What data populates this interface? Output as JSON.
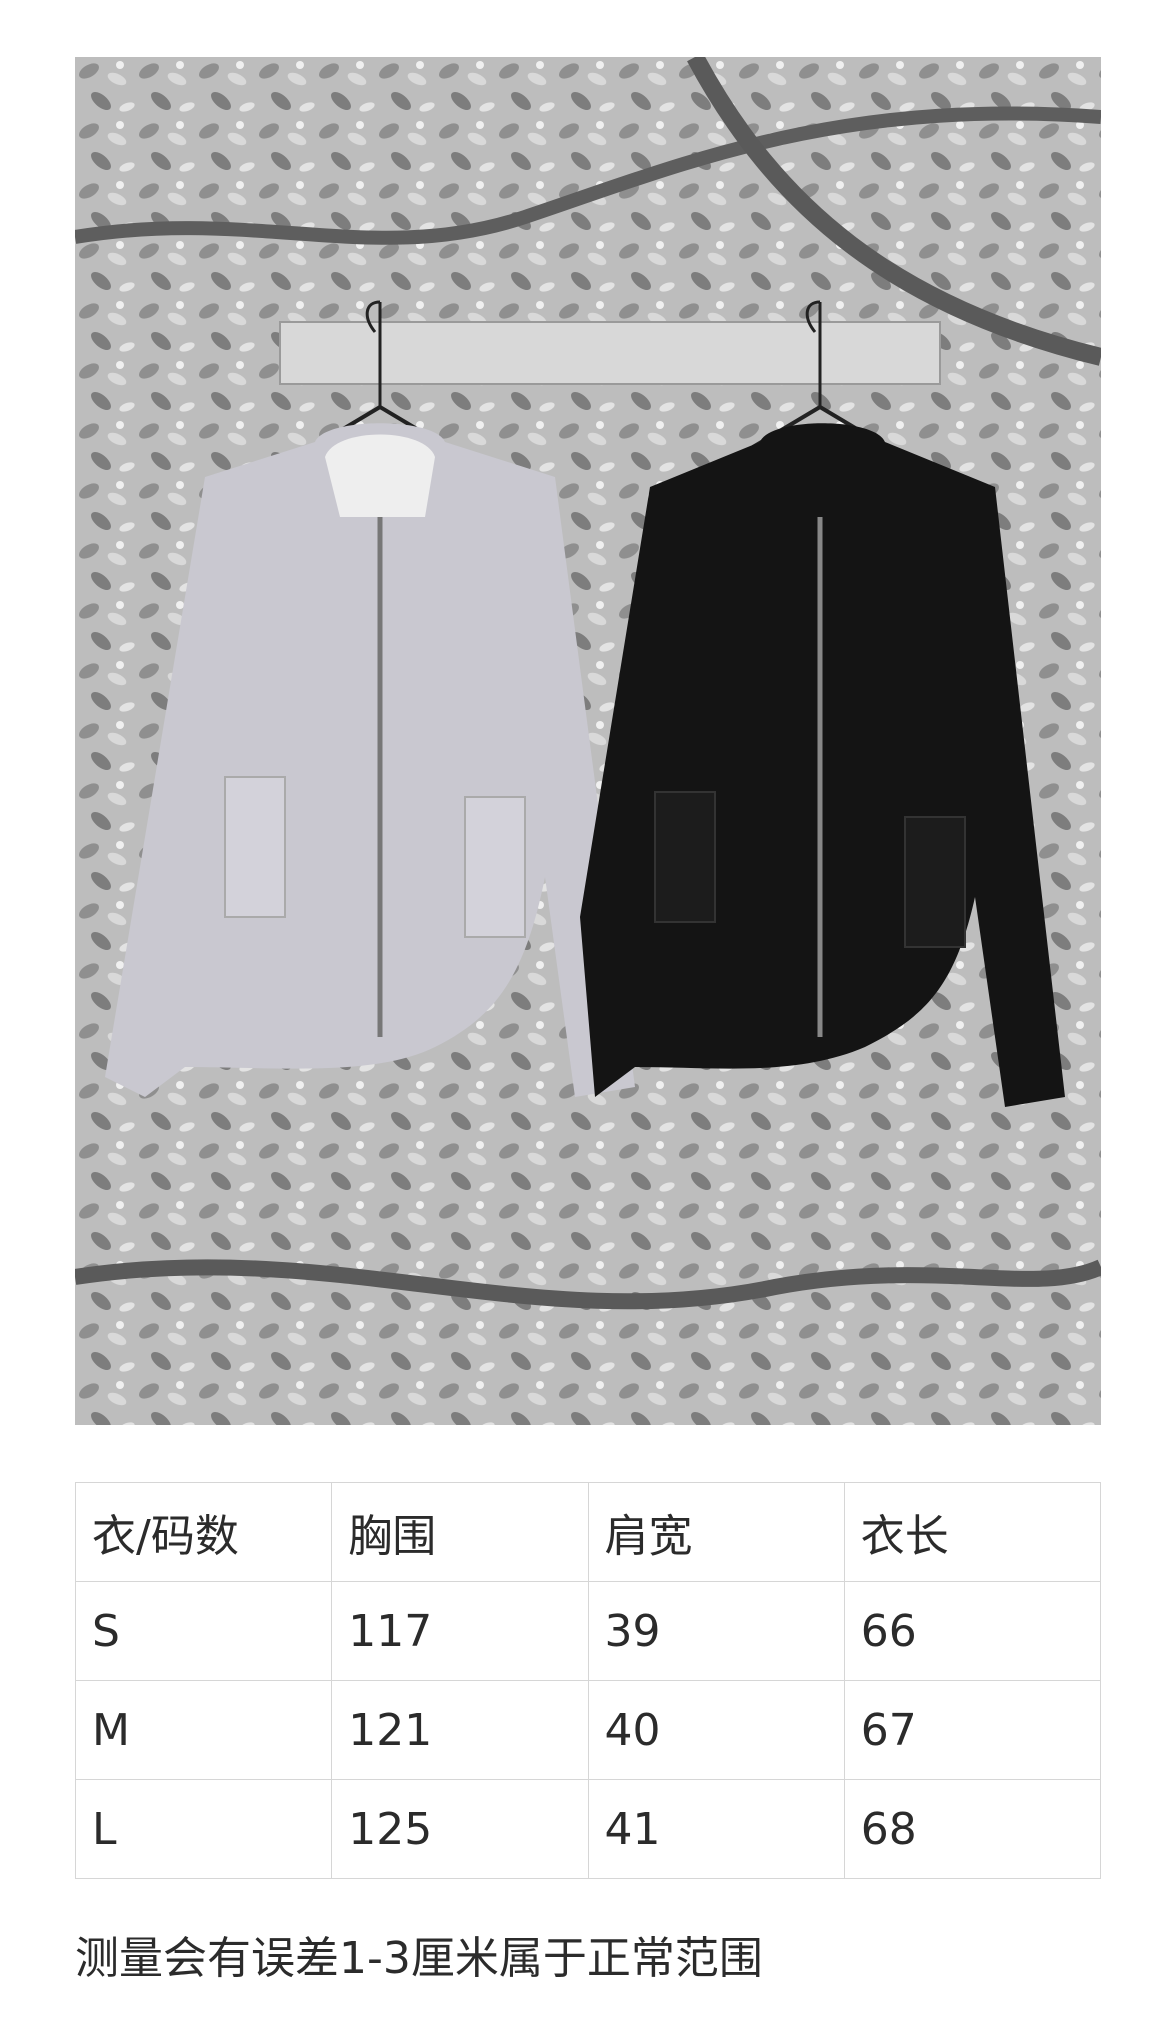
{
  "product_photo": {
    "alt": "",
    "garments": [
      {
        "color_name": "lavender-grey",
        "color": "#c9c8d0"
      },
      {
        "color_name": "black",
        "color": "#141414"
      }
    ],
    "background_color": "#b5b5b5"
  },
  "size_table": {
    "headers": [
      "衣/码数",
      "胸围",
      "肩宽",
      "衣长"
    ],
    "rows": [
      [
        "S",
        "117",
        "39",
        "66"
      ],
      [
        "M",
        "121",
        "40",
        "67"
      ],
      [
        "L",
        "125",
        "41",
        "68"
      ]
    ]
  },
  "note": "测量会有误差1-3厘米属于正常范围"
}
